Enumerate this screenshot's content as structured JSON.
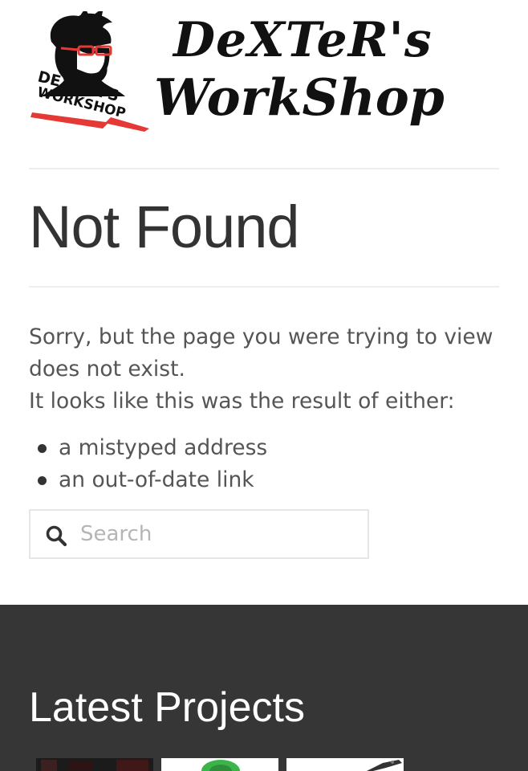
{
  "site": {
    "brand_line1": "DeXTeR's",
    "brand_line2": "WorkShop",
    "badge_line1": "DEXTER'S",
    "badge_line2": "WORKSHOP"
  },
  "page": {
    "title": "Not Found",
    "message_line1": "Sorry, but the page you were trying to view does not exist.",
    "message_line2": "It looks like this was the result of either:",
    "reasons": [
      "a mistyped address",
      "an out-of-date link"
    ]
  },
  "search": {
    "placeholder": "Search",
    "value": ""
  },
  "footer": {
    "title": "Latest Projects"
  },
  "colors": {
    "footer_bg": "#363636",
    "logo_accent": "#e53935",
    "text": "#555555",
    "heading": "#333333"
  }
}
